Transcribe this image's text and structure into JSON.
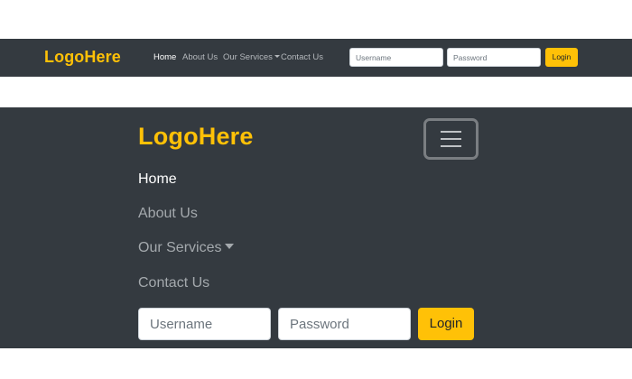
{
  "brand": {
    "logo_text": "LogoHere"
  },
  "nav": {
    "items": [
      {
        "label": "Home",
        "active": true
      },
      {
        "label": "About Us",
        "active": false
      },
      {
        "label": "Our Services",
        "active": false,
        "dropdown": true
      },
      {
        "label": "Contact Us",
        "active": false
      }
    ]
  },
  "login_form": {
    "username_placeholder": "Username",
    "password_placeholder": "Password",
    "submit_label": "Login"
  },
  "colors": {
    "navbar_bg": "#343a40",
    "brand": "#ffc107",
    "button_bg": "#ffc107",
    "nav_active": "#ffffff",
    "nav_inactive": "#a4a9ad"
  },
  "icons": {
    "toggler": "hamburger-icon",
    "dropdown": "caret-down-icon"
  }
}
